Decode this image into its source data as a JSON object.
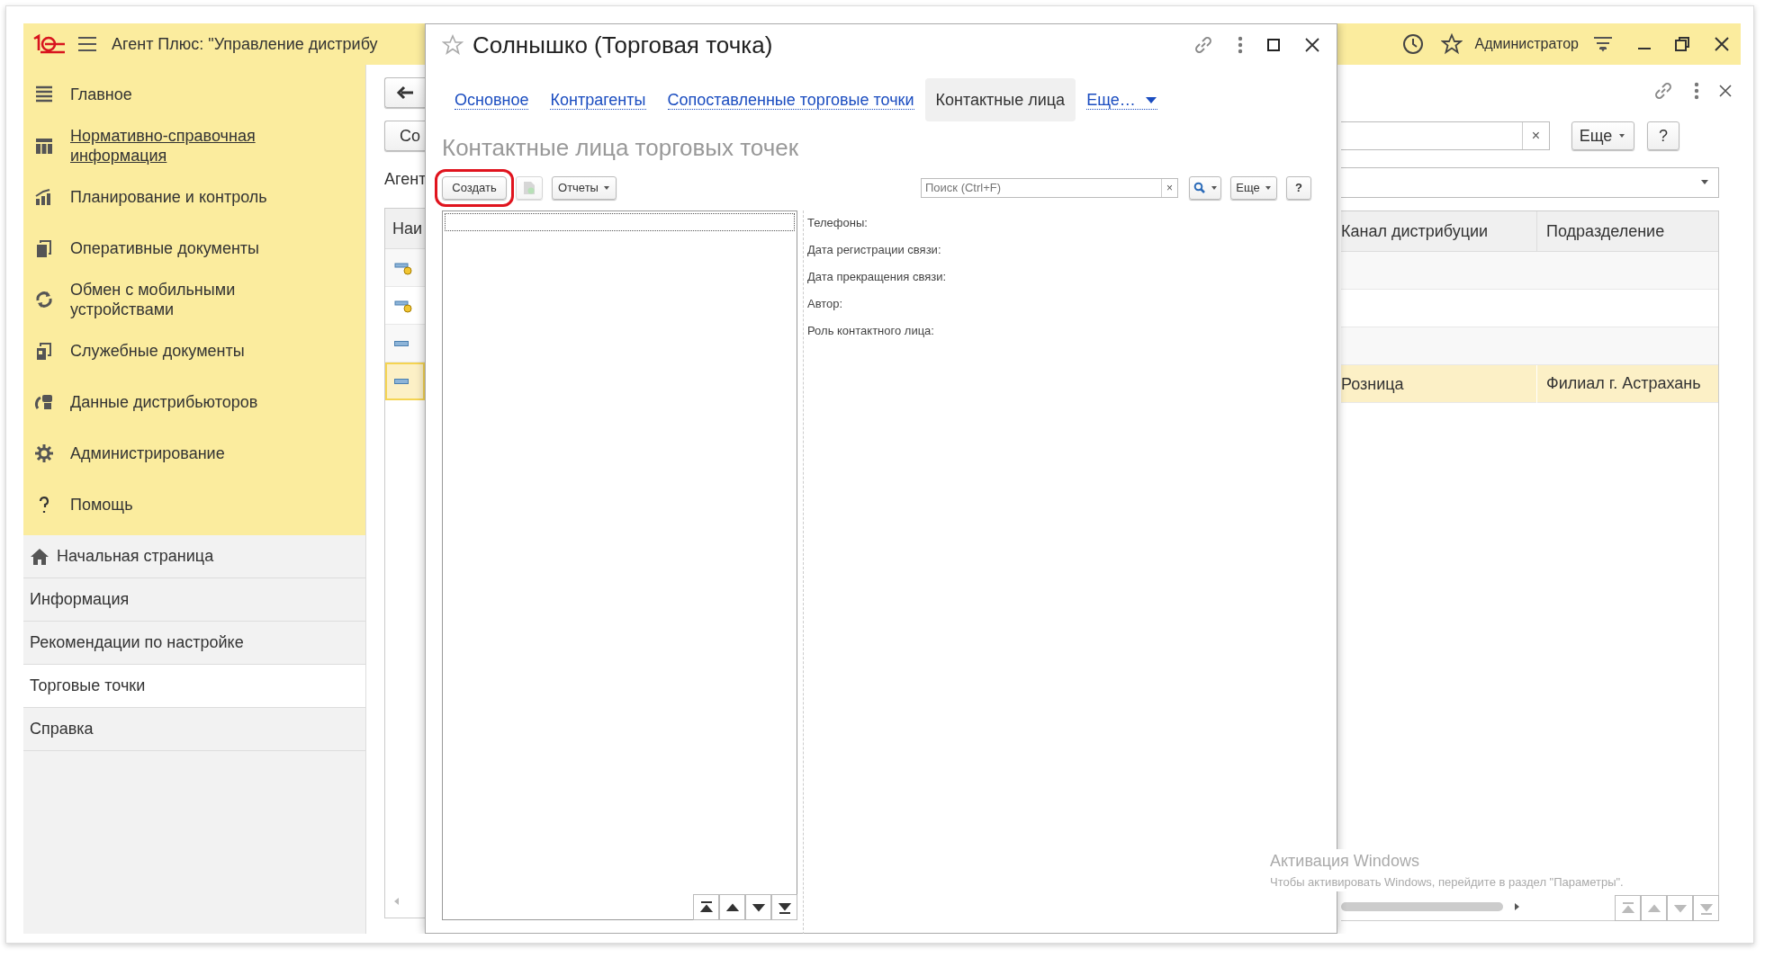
{
  "app": {
    "title": "Агент Плюс: \"Управление дистрибу",
    "user": "Администратор"
  },
  "sections": [
    {
      "label": "Главное",
      "underlined": false
    },
    {
      "label": "Нормативно-справочная информация",
      "underlined": true
    },
    {
      "label": "Планирование и контроль",
      "underlined": false
    },
    {
      "label": "Оперативные документы",
      "underlined": false
    },
    {
      "label": "Обмен с мобильными устройствами",
      "underlined": false
    },
    {
      "label": "Служебные документы",
      "underlined": false
    },
    {
      "label": "Данные дистрибьюторов",
      "underlined": false
    },
    {
      "label": "Администрирование",
      "underlined": false
    },
    {
      "label": "Помощь",
      "underlined": false
    }
  ],
  "open_pages": [
    {
      "label": "Начальная страница",
      "selected": false
    },
    {
      "label": "Информация",
      "selected": false
    },
    {
      "label": "Рекомендации по настройке",
      "selected": false
    },
    {
      "label": "Торговые точки",
      "selected": true
    },
    {
      "label": "Справка",
      "selected": false
    }
  ],
  "list_form": {
    "create_button": "Со",
    "caption": "Агент",
    "more_button": "Еще",
    "help_button": "?",
    "columns": [
      "Наи",
      "Канал дистрибуции",
      "Подразделение"
    ],
    "rows": [
      {
        "kind": "marked",
        "selected": false
      },
      {
        "kind": "marked",
        "selected": false
      },
      {
        "kind": "plain",
        "selected": false
      },
      {
        "kind": "plain",
        "selected": true,
        "cells": [
          "Розница",
          "Филиал г. Астрахань"
        ]
      }
    ]
  },
  "dialog": {
    "title": "Солнышко (Торговая точка)",
    "tabs": [
      {
        "label": "Основное",
        "selected": false
      },
      {
        "label": "Контрагенты",
        "selected": false
      },
      {
        "label": "Сопоставленные торговые точки",
        "selected": false
      },
      {
        "label": "Контактные лица",
        "selected": true
      },
      {
        "label": "Еще…",
        "selected": false,
        "kind": "menu"
      }
    ],
    "heading": "Контактные лица торговых точек",
    "toolbar": {
      "create": "Создать",
      "create_highlighted": true,
      "reports": "Отчеты",
      "search_placeholder": "Поиск (Ctrl+F)",
      "clear": "×",
      "more": "Еще",
      "help": "?"
    },
    "details": [
      "Телефоны:",
      "Дата регистрации связи:",
      "Дата прекращения связи:",
      "Автор:",
      "Роль контактного лица:"
    ]
  },
  "os_notice": {
    "title": "Активация Windows",
    "text": "Чтобы активировать Windows, перейдите в раздел \"Параметры\"."
  }
}
